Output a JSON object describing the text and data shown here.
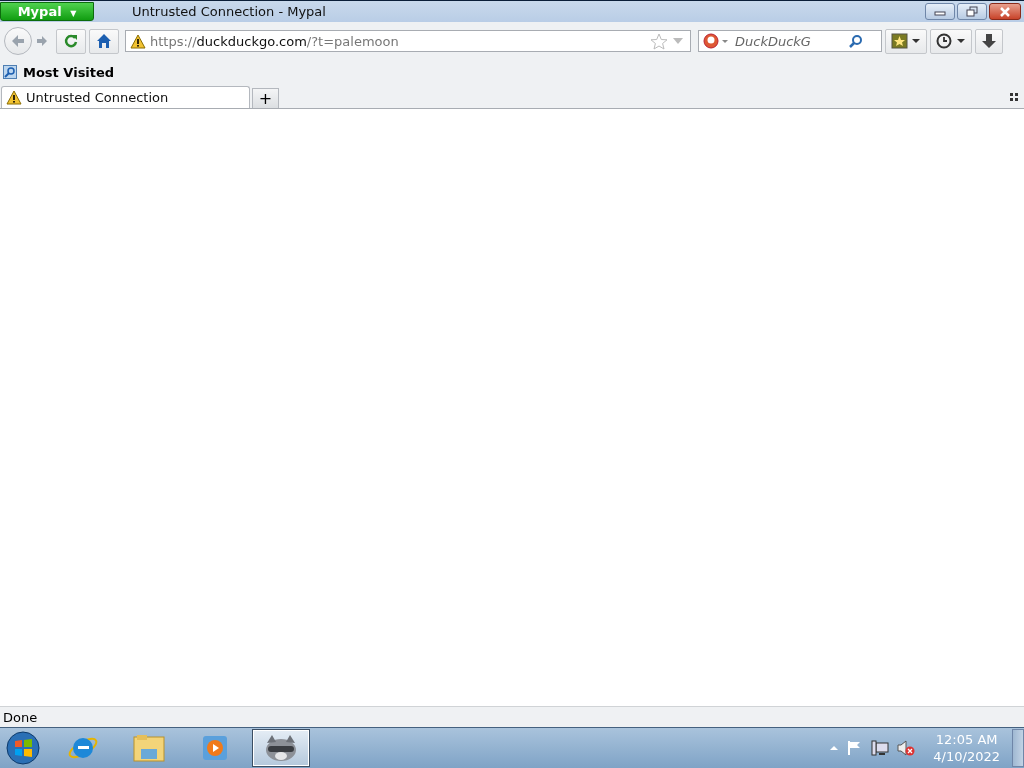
{
  "window": {
    "title": "Untrusted Connection - Mypal",
    "app_menu": "Mypal",
    "app_menu_caret": "▼"
  },
  "navbar": {
    "url_scheme": "https://",
    "url_host": "duckduckgo.com",
    "url_rest": "/?t=palemoon",
    "search_placeholder": "DuckDuckG"
  },
  "bookmarks": [
    {
      "label": "Most Visited"
    }
  ],
  "tabs": [
    {
      "label": "Untrusted Connection",
      "selected": true
    }
  ],
  "new_tab": "+",
  "status_bar": "Done",
  "taskbar": {
    "apps": [
      {
        "selected": false
      },
      {
        "selected": false
      },
      {
        "selected": false
      },
      {
        "selected": true
      }
    ],
    "time": "12:05 AM",
    "date": "4/10/2022"
  }
}
